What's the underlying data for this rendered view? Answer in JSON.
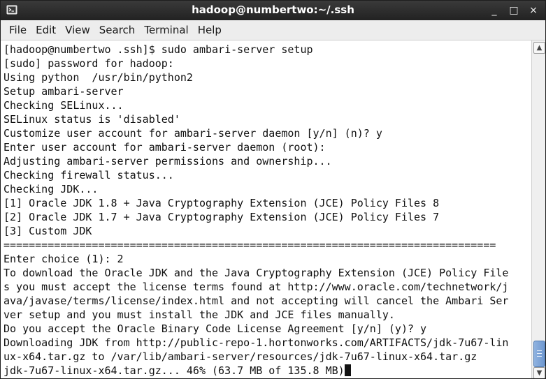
{
  "window": {
    "title": "hadoop@numbertwo:~/.ssh",
    "controls": {
      "minimize": "_",
      "maximize": "□",
      "close": "×"
    }
  },
  "menu": {
    "file": "File",
    "edit": "Edit",
    "view": "View",
    "search": "Search",
    "terminal": "Terminal",
    "help": "Help"
  },
  "terminal": {
    "lines": [
      "[hadoop@numbertwo .ssh]$ sudo ambari-server setup",
      "[sudo] password for hadoop:",
      "Using python  /usr/bin/python2",
      "Setup ambari-server",
      "Checking SELinux...",
      "SELinux status is 'disabled'",
      "Customize user account for ambari-server daemon [y/n] (n)? y",
      "Enter user account for ambari-server daemon (root):",
      "Adjusting ambari-server permissions and ownership...",
      "Checking firewall status...",
      "Checking JDK...",
      "[1] Oracle JDK 1.8 + Java Cryptography Extension (JCE) Policy Files 8",
      "[2] Oracle JDK 1.7 + Java Cryptography Extension (JCE) Policy Files 7",
      "[3] Custom JDK",
      "==============================================================================",
      "Enter choice (1): 2",
      "To download the Oracle JDK and the Java Cryptography Extension (JCE) Policy File",
      "s you must accept the license terms found at http://www.oracle.com/technetwork/j",
      "ava/javase/terms/license/index.html and not accepting will cancel the Ambari Ser",
      "ver setup and you must install the JDK and JCE files manually.",
      "Do you accept the Oracle Binary Code License Agreement [y/n] (y)? y",
      "Downloading JDK from http://public-repo-1.hortonworks.com/ARTIFACTS/jdk-7u67-lin",
      "ux-x64.tar.gz to /var/lib/ambari-server/resources/jdk-7u67-linux-x64.tar.gz",
      "jdk-7u67-linux-x64.tar.gz... 46% (63.7 MB of 135.8 MB)"
    ]
  },
  "colors": {
    "titlebar": "#2b2b2b",
    "menubar": "#ededed",
    "terminal_bg": "#ffffff",
    "terminal_fg": "#111111",
    "scroll_thumb": "#7ea4d8"
  },
  "icons": {
    "app": "terminal-icon",
    "scroll_up": "scroll-up-arrow-icon",
    "scroll_down": "scroll-down-arrow-icon"
  }
}
